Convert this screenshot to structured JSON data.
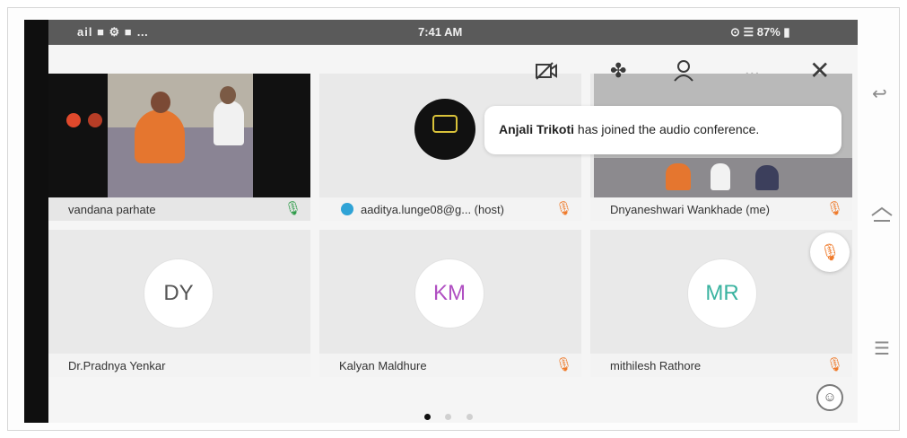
{
  "status_bar": {
    "left_text": "ail ■ ⚙ ■ …",
    "time": "7:41 AM",
    "right_text": "⊙ ☰ 87% ▮"
  },
  "toolbar": {
    "video_off_icon": "video-off",
    "bluetooth_icon": "bluetooth",
    "participants_icon": "participants",
    "more_label": "...",
    "close_icon": "close"
  },
  "toast": {
    "name": "Anjali Trikoti",
    "message": " has joined the audio conference."
  },
  "tiles": [
    {
      "name": "vandana parhate",
      "mic": "on"
    },
    {
      "name": "aaditya.lunge08@g... (host)",
      "mic": "muted"
    },
    {
      "name": "Dnyaneshwari Wankhade (me)",
      "mic": "muted"
    },
    {
      "name": "Dr.Pradnya Yenkar",
      "initials": "DY",
      "mic": "none",
      "color": "#555555"
    },
    {
      "name": "Kalyan Maldhure",
      "initials": "KM",
      "mic": "muted",
      "color": "#b04fc2"
    },
    {
      "name": "mithilesh Rathore",
      "initials": "MR",
      "mic": "muted",
      "color": "#3ab3a0"
    }
  ],
  "pagination": {
    "pages": 3,
    "current": 1
  },
  "colors": {
    "accent_orange": "#ef7a2a",
    "mic_on_green": "#2f9c4a"
  }
}
